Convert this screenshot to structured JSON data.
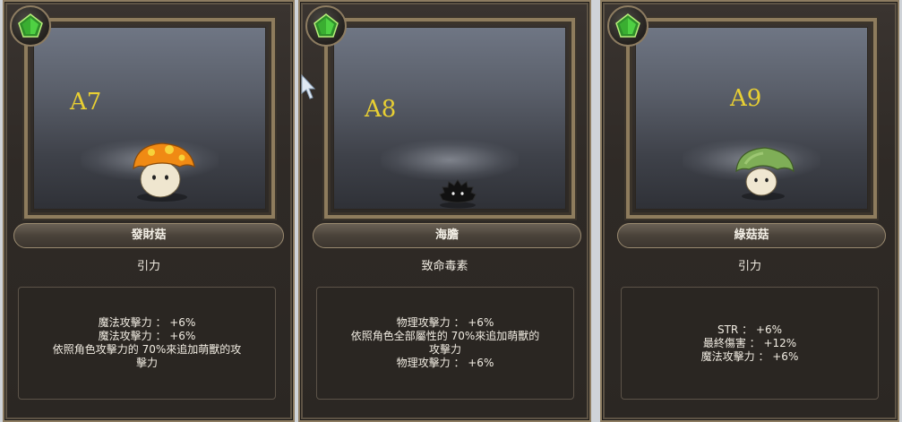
{
  "cards": [
    {
      "code": "A7",
      "name": "發財菇",
      "skill": "引力",
      "effects": [
        "魔法攻擊力 ： +6%",
        "魔法攻擊力 ： +6%",
        "依照角色攻擊力的 70%來追加萌獸的攻",
        "擊力"
      ]
    },
    {
      "code": "A8",
      "name": "海膽",
      "skill": "致命毒素",
      "effects": [
        "物理攻擊力 ： +6%",
        "依照角色全部屬性的 70%來追加萌獸的",
        "攻擊力",
        "物理攻擊力 ： +6%"
      ]
    },
    {
      "code": "A9",
      "name": "綠菇菇",
      "skill": "引力",
      "effects": [
        "STR ： +6%",
        "最終傷害 ： +12%",
        "魔法攻擊力 ： +6%"
      ]
    }
  ],
  "colors": {
    "code_yellow": "#e8cf33",
    "frame_gold": "#8e7c5d",
    "gem_green": "#3fbf3a"
  },
  "icons": {
    "gem": "green-pentagon-gem-icon"
  }
}
